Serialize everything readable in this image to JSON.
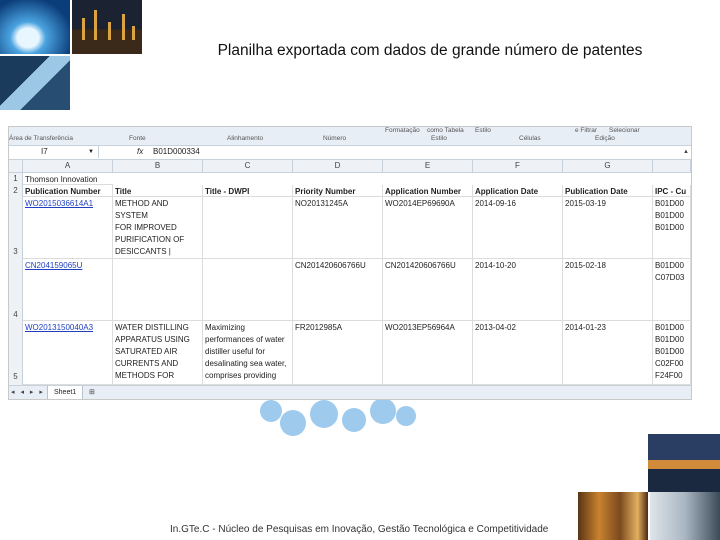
{
  "title": "Planilha exportada com dados de grande número de patentes",
  "footer": "In.GTe.C - Núcleo de Pesquisas em Inovação, Gestão Tecnológica e Competitividade",
  "spreadsheet": {
    "ribbon": {
      "groups_top": [
        "Formatação",
        "como Tabela",
        "Estilo",
        "Células",
        "e Filtrar",
        "Selecionar"
      ],
      "groups": [
        "Área de Transferência",
        "Fonte",
        "Alinhamento",
        "Número",
        "Estilo",
        "Células",
        "Edição"
      ]
    },
    "name_box": "I7",
    "fx_label": "fx",
    "formula_value": "B01D000334",
    "column_letters": [
      "A",
      "B",
      "C",
      "D",
      "E",
      "F",
      "G"
    ],
    "row_numbers": [
      "1",
      "2",
      "3",
      "4",
      "5"
    ],
    "row1_text": "Thomson Innovation",
    "headers": [
      "Publication Number",
      "Title",
      "Title - DWPI",
      "Priority Number",
      "Application Number",
      "Application Date",
      "Publication Date",
      "IPC - Cu"
    ],
    "rows": [
      {
        "publication_number": "WO2015036614A1",
        "title": "METHOD AND SYSTEM\nFOR IMPROVED\nPURIFICATION OF\nDESICCANTS |\nPROCÉDÉ ET SYSTÈME",
        "title_dwpi": "",
        "priority_number": "NO20131245A",
        "application_number": "WO2014EP69690A",
        "application_date": "2014-09-16",
        "publication_date": "2015-03-19",
        "ipc": "B01D00\nB01D00\nB01D00"
      },
      {
        "publication_number": "CN204159065U",
        "title": "",
        "title_dwpi": "",
        "priority_number": "CN201420606766U",
        "application_number": "CN201420606766U",
        "application_date": "2014-10-20",
        "publication_date": "2015-02-18",
        "ipc": "B01D00\nC07D03"
      },
      {
        "publication_number": "WO2013150040A3",
        "title": "WATER DISTILLING\nAPPARATUS USING\nSATURATED AIR\nCURRENTS AND\nMETHODS FOR",
        "title_dwpi": "Maximizing\nperformances of water\ndistiller useful for\ndesalinating sea water,\ncomprises providing",
        "priority_number": "FR2012985A",
        "application_number": "WO2013EP56964A",
        "application_date": "2013-04-02",
        "publication_date": "2014-01-23",
        "ipc": "B01D00\nB01D00\nB01D00\nC02F00\nF24F00"
      }
    ],
    "sheet_tab": "Sheet1",
    "tab_nav": "◂ ◂ ▸ ▸"
  }
}
